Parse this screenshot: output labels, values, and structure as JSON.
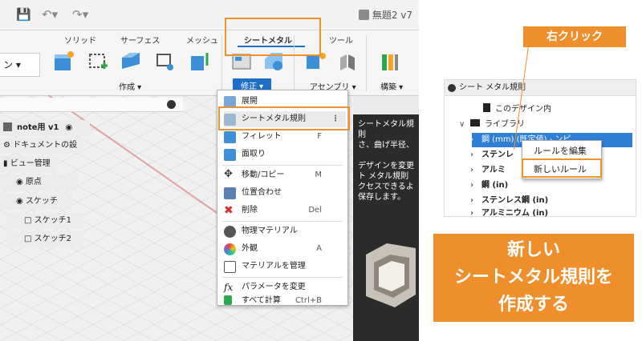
{
  "window": {
    "doc_title": "無題2 v7"
  },
  "ribbon": {
    "tabs": [
      "ソリッド",
      "サーフェス",
      "メッシュ",
      "シートメタル",
      "ツール"
    ],
    "left_dropdown": "ン ▾",
    "groups": [
      "作成 ▾",
      "修正 ▾",
      "アセンブリ ▾",
      "構築 ▾"
    ]
  },
  "browser": {
    "root": "note用 v1",
    "items": [
      "ドキュメントの設定",
      "ビュー管理",
      "原点",
      "スケッチ",
      "スケッチ1",
      "スケッチ2"
    ]
  },
  "context_menu": {
    "items": [
      {
        "label": "展開",
        "shortcut": "",
        "icon": "unfold-icon"
      },
      {
        "label": "シートメタル規則",
        "shortcut": "⋮",
        "icon": "sheet-metal-rules-icon"
      },
      {
        "label": "フィレット",
        "shortcut": "F",
        "icon": "fillet-icon"
      },
      {
        "label": "面取り",
        "shortcut": "",
        "icon": "chamfer-icon"
      },
      {
        "label": "移動/コピー",
        "shortcut": "M",
        "icon": "move-icon"
      },
      {
        "label": "位置合わせ",
        "shortcut": "",
        "icon": "align-icon"
      },
      {
        "label": "削除",
        "shortcut": "Del",
        "icon": "delete-icon"
      },
      {
        "label": "物理マテリアル",
        "shortcut": "",
        "icon": "physical-material-icon"
      },
      {
        "label": "外観",
        "shortcut": "A",
        "icon": "appearance-icon"
      },
      {
        "label": "マテリアルを管理",
        "shortcut": "",
        "icon": "manage-materials-icon"
      },
      {
        "label": "パラメータを変更",
        "shortcut": "",
        "icon": "change-parameters-icon"
      },
      {
        "label": "すべて計算",
        "shortcut": "Ctrl+B",
        "icon": "compute-all-icon"
      }
    ]
  },
  "help_panel": {
    "text": "シートメタル規則\nさ、曲げ半径、\n\nデザインを変更\nト メタル規則\nクセスできるよ\n保存します。"
  },
  "rules_panel": {
    "header": "シート メタル規則",
    "rows": [
      {
        "label": "このデザイン内",
        "indent": 1,
        "arrow": ""
      },
      {
        "label": "ライブラリ",
        "indent": 1,
        "arrow": "v"
      },
      {
        "label": "鋼 (mm) (既定値) - ンピ",
        "indent": 2,
        "arrow": ">",
        "selected": true
      },
      {
        "label": "ステンレ",
        "indent": 2,
        "arrow": ">"
      },
      {
        "label": "アルミ",
        "indent": 2,
        "arrow": ">"
      },
      {
        "label": "鋼 (in)",
        "indent": 2,
        "arrow": ">"
      },
      {
        "label": "ステンレス鋼 (in)",
        "indent": 2,
        "arrow": ">"
      },
      {
        "label": "アルミニウム (in)",
        "indent": 2,
        "arrow": ">"
      }
    ],
    "menu": [
      "ルールを編集",
      "新しいルール"
    ]
  },
  "annotations": {
    "right_click": "右クリック",
    "caption_lines": [
      "新しい",
      "シートメタル規則を",
      "作成する"
    ]
  },
  "colors": {
    "accent": "#ef8f2c",
    "selection": "#2f7fd6"
  }
}
